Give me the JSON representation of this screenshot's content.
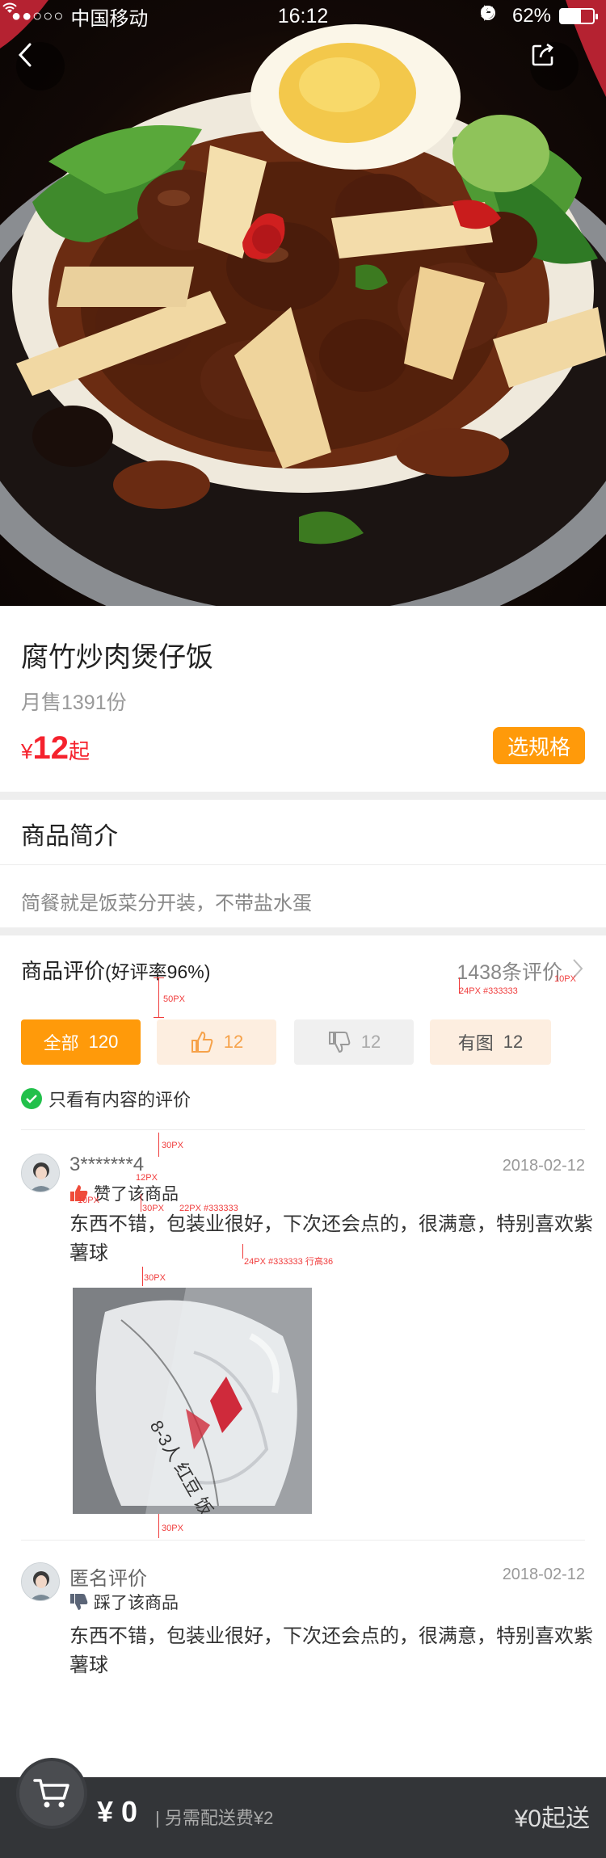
{
  "status_bar": {
    "signal": "●●○○○",
    "carrier": "中国移动",
    "time": "16:12",
    "battery_text": "62%",
    "battery_level": 0.62
  },
  "nav": {
    "back_icon": "back-chevron-icon",
    "share_icon": "share-icon"
  },
  "product": {
    "title": "腐竹炒肉煲仔饭",
    "monthly_sales": "月售1391份",
    "price_currency": "¥",
    "price_value": "12",
    "price_suffix": "起",
    "spec_button": "选规格"
  },
  "intro": {
    "heading": "商品简介",
    "text": "简餐就是饭菜分开装，不带盐水蛋"
  },
  "reviews": {
    "heading": "商品评价",
    "rate": "(好评率96%)",
    "count": "1438条评价",
    "filters": [
      {
        "label": "全部",
        "count": "120"
      },
      {
        "label": "",
        "count": "12",
        "icon": "thumbs-up-icon"
      },
      {
        "label": "",
        "count": "12",
        "icon": "thumbs-down-icon"
      },
      {
        "label": "有图",
        "count": "12"
      }
    ],
    "only_content": "只看有内容的评价",
    "items": [
      {
        "user": "3*******4",
        "date": "2018-02-12",
        "action": "赞了该商品",
        "action_icon": "thumbs-up-icon",
        "text": "东西不错，包装业很好，下次还会点的，很满意，特别喜欢紫薯球",
        "has_photo": true,
        "photo_text": "8-3人 红豆 饭"
      },
      {
        "user": "匿名评价",
        "date": "2018-02-12",
        "action": "踩了该商品",
        "action_icon": "thumbs-down-icon",
        "text": "东西不错，包装业很好，下次还会点的，很满意，特别喜欢紫薯球",
        "has_photo": false
      }
    ]
  },
  "annotations": {
    "a1": "50PX",
    "a2": "24PX #333333",
    "a3": "10PX",
    "a4": "30PX",
    "a5": "12PX",
    "a6": "10PX",
    "a7": "30PX",
    "a8": "22PX #333333",
    "a9": "24PX #333333 行高36",
    "a10": "30PX",
    "a11": "30PX"
  },
  "cart": {
    "icon": "cart-icon",
    "total": "¥ 0",
    "delivery_fee": "| 另需配送费¥2",
    "minimum": "¥0起送"
  }
}
